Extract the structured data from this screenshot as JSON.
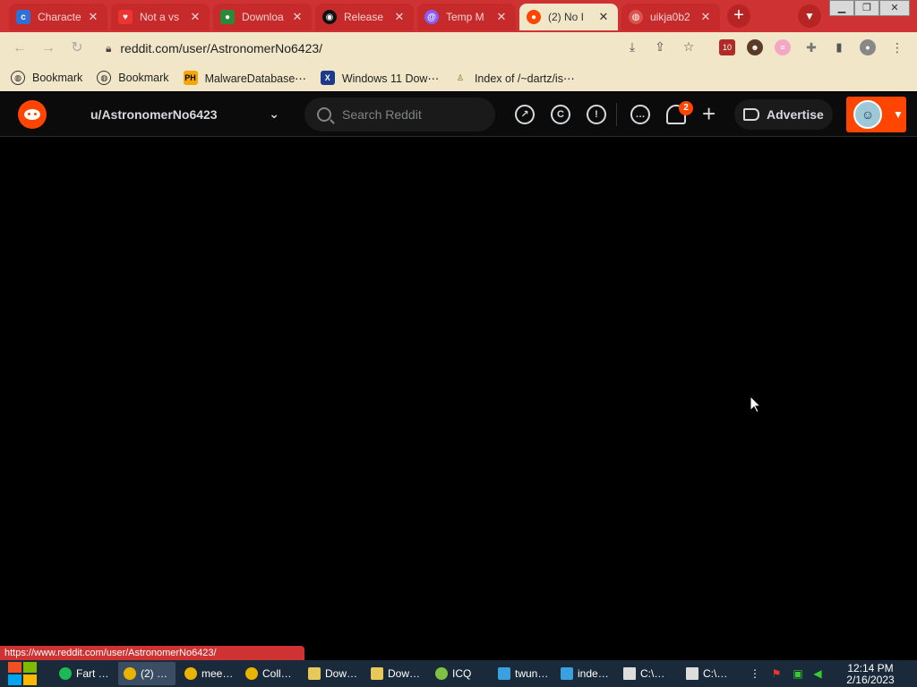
{
  "browser": {
    "tabs": [
      {
        "title": "Characte",
        "icon": "character-ai-icon",
        "color": "#2f6fd6"
      },
      {
        "title": "Not a vs",
        "icon": "heart-icon",
        "color": "#e33"
      },
      {
        "title": "Downloa",
        "icon": "download-site-icon",
        "color": "#2a8a3a"
      },
      {
        "title": "Release",
        "icon": "github-icon",
        "color": "#111"
      },
      {
        "title": "Temp M",
        "icon": "temp-mail-icon",
        "color": "#8a5cf6"
      },
      {
        "title": "(2) No I",
        "icon": "reddit-icon",
        "color": "#ff4500",
        "active": true
      },
      {
        "title": "uikja0b2",
        "icon": "globe-icon",
        "color": "#d9534f"
      }
    ],
    "url": "reddit.com/user/AstronomerNo6423/",
    "extension_badge": "10",
    "bookmarks": [
      {
        "label": "Bookmark",
        "icon": "globe-icon"
      },
      {
        "label": "Bookmark",
        "icon": "globe-icon"
      },
      {
        "label": "MalwareDatabase⋯",
        "icon": "ph-icon"
      },
      {
        "label": "Windows 11 Dow⋯",
        "icon": "x-icon"
      },
      {
        "label": "Index of /~dartz/is⋯",
        "icon": "folder-person-icon"
      }
    ],
    "status_url": "https://www.reddit.com/user/AstronomerNo6423/"
  },
  "reddit": {
    "community_selector": "u/AstronomerNo6423",
    "search_placeholder": "Search Reddit",
    "notification_count": "2",
    "advertise_label": "Advertise"
  },
  "taskbar": {
    "items": [
      {
        "label": "Fart …",
        "icon": "spotify-icon",
        "color": "#1db954"
      },
      {
        "label": "(2) …",
        "icon": "chrome-icon",
        "color": "#e8b400",
        "selected": true
      },
      {
        "label": "mee…",
        "icon": "chrome-icon",
        "color": "#e8b400"
      },
      {
        "label": "Coll…",
        "icon": "chrome-icon",
        "color": "#e8b400"
      },
      {
        "label": "Dow…",
        "icon": "folder-icon",
        "color": "#e6c95a"
      },
      {
        "label": "Dow…",
        "icon": "folder-icon",
        "color": "#e6c95a"
      },
      {
        "label": "ICQ",
        "icon": "icq-icon",
        "color": "#7dc242"
      },
      {
        "label": "twun…",
        "icon": "terminal-icon",
        "color": "#3aa0e0"
      },
      {
        "label": "inde…",
        "icon": "terminal-icon",
        "color": "#3aa0e0"
      },
      {
        "label": "C:\\…",
        "icon": "7zip-icon",
        "color": "#ddd"
      },
      {
        "label": "C:\\…",
        "icon": "7zip-icon",
        "color": "#ddd"
      }
    ],
    "time": "12:14 PM",
    "date": "2/16/2023"
  }
}
